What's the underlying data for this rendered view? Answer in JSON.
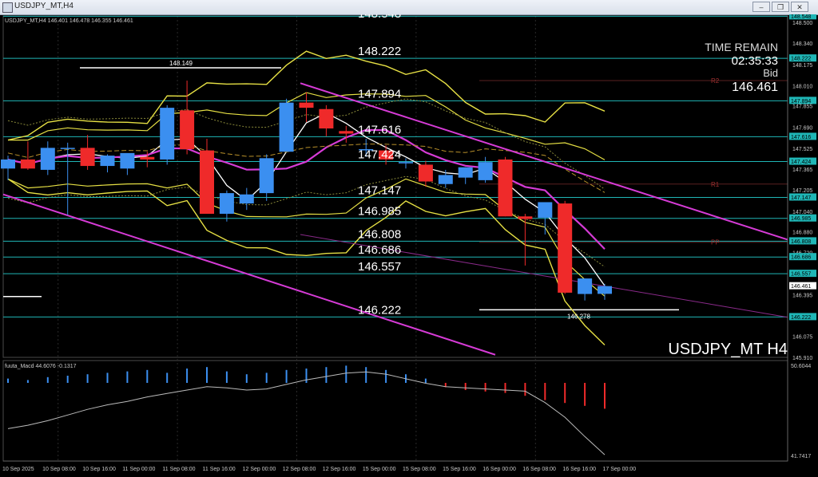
{
  "window": {
    "title": "USDJPY_MT,H4",
    "buttons": [
      "minimize",
      "restore",
      "close"
    ]
  },
  "colors": {
    "background": "#000000",
    "bull_candle": "#3b8ff0",
    "bear_candle": "#ef2a2a",
    "bollinger": "#e6e044",
    "channel": "#d63bd6",
    "level_line": "#1fb6b6",
    "ma_white": "#ffffff",
    "axis_text": "#c8c8c8"
  },
  "chart_data": [
    {
      "type": "candlestick",
      "symbol_label": "USDJPY_MT H4",
      "header": "USDJPY_MT,H4  146.401 146.478 146.355 146.461",
      "ylim": [
        145.91,
        148.55
      ],
      "ticks_y": [
        148.5,
        148.34,
        148.175,
        148.01,
        147.855,
        147.69,
        147.525,
        147.365,
        147.205,
        147.04,
        146.88,
        146.72,
        146.395,
        146.235,
        146.075,
        145.91
      ],
      "x_labels": [
        "10 Sep 2025",
        "10 Sep 08:00",
        "10 Sep 16:00",
        "11 Sep 00:00",
        "11 Sep 08:00",
        "11 Sep 16:00",
        "12 Sep 00:00",
        "12 Sep 08:00",
        "12 Sep 16:00",
        "15 Sep 00:00",
        "15 Sep 08:00",
        "15 Sep 16:00",
        "16 Sep 00:00",
        "16 Sep 08:00",
        "16 Sep 16:00",
        "17 Sep 00:00"
      ],
      "candles": [
        {
          "o": 147.37,
          "h": 147.47,
          "l": 147.28,
          "c": 147.44
        },
        {
          "o": 147.44,
          "h": 147.58,
          "l": 147.36,
          "c": 147.37
        },
        {
          "o": 147.36,
          "h": 147.58,
          "l": 147.32,
          "c": 147.53
        },
        {
          "o": 147.53,
          "h": 147.57,
          "l": 147.01,
          "c": 147.53
        },
        {
          "o": 147.53,
          "h": 147.63,
          "l": 147.36,
          "c": 147.39
        },
        {
          "o": 147.39,
          "h": 147.48,
          "l": 147.34,
          "c": 147.47
        },
        {
          "o": 147.37,
          "h": 147.48,
          "l": 147.32,
          "c": 147.49
        },
        {
          "o": 147.46,
          "h": 147.5,
          "l": 147.38,
          "c": 147.44
        },
        {
          "o": 147.44,
          "h": 147.86,
          "l": 147.4,
          "c": 147.84
        },
        {
          "o": 147.82,
          "h": 148.05,
          "l": 147.48,
          "c": 147.52
        },
        {
          "o": 147.51,
          "h": 147.6,
          "l": 147.05,
          "c": 147.02
        },
        {
          "o": 147.02,
          "h": 147.2,
          "l": 146.96,
          "c": 147.18
        },
        {
          "o": 147.1,
          "h": 147.22,
          "l": 147.05,
          "c": 147.17
        },
        {
          "o": 147.18,
          "h": 147.48,
          "l": 147.12,
          "c": 147.45
        },
        {
          "o": 147.5,
          "h": 147.91,
          "l": 147.5,
          "c": 147.88
        },
        {
          "o": 147.88,
          "h": 147.96,
          "l": 147.73,
          "c": 147.84
        },
        {
          "o": 147.83,
          "h": 147.86,
          "l": 147.62,
          "c": 147.68
        },
        {
          "o": 147.66,
          "h": 147.7,
          "l": 147.57,
          "c": 147.64
        },
        {
          "o": 147.52,
          "h": 147.6,
          "l": 147.46,
          "c": 147.52
        },
        {
          "o": 147.51,
          "h": 147.55,
          "l": 147.4,
          "c": 147.44
        },
        {
          "o": 147.41,
          "h": 147.45,
          "l": 147.37,
          "c": 147.42
        },
        {
          "o": 147.4,
          "h": 147.43,
          "l": 147.23,
          "c": 147.27
        },
        {
          "o": 147.25,
          "h": 147.36,
          "l": 147.22,
          "c": 147.32
        },
        {
          "o": 147.3,
          "h": 147.38,
          "l": 147.25,
          "c": 147.38
        },
        {
          "o": 147.28,
          "h": 147.46,
          "l": 147.26,
          "c": 147.42
        },
        {
          "o": 147.44,
          "h": 147.46,
          "l": 147.0,
          "c": 147.0
        },
        {
          "o": 147.0,
          "h": 147.02,
          "l": 146.62,
          "c": 146.98
        },
        {
          "o": 146.99,
          "h": 147.1,
          "l": 146.86,
          "c": 147.11
        },
        {
          "o": 147.1,
          "h": 147.12,
          "l": 146.4,
          "c": 146.41
        },
        {
          "o": 146.4,
          "h": 146.52,
          "l": 146.35,
          "c": 146.52
        },
        {
          "o": 146.401,
          "h": 146.478,
          "l": 146.355,
          "c": 146.461
        }
      ],
      "levels": [
        {
          "label": "148.222",
          "value": 148.222
        },
        {
          "label": "147.894",
          "value": 147.894
        },
        {
          "label": "147.616",
          "value": 147.616
        },
        {
          "label": "147.424",
          "value": 147.424
        },
        {
          "label": "147.147",
          "value": 147.147
        },
        {
          "label": "146.985",
          "value": 146.985
        },
        {
          "label": "146.808",
          "value": 146.808
        },
        {
          "label": "146.686",
          "value": 146.686
        },
        {
          "label": "146.557",
          "value": 146.557
        },
        {
          "label": "146.222",
          "value": 146.222
        }
      ],
      "axis_tags": [
        "148.548",
        "148.222",
        "147.894",
        "147.616",
        "147.424",
        "147.147",
        "146.985",
        "146.808",
        "146.686",
        "146.557",
        "146.461",
        "146.222"
      ],
      "pivot_labels": [
        "R2",
        "R1",
        "PP"
      ],
      "swing_labels": [
        {
          "text": "148.149",
          "value": 148.149
        },
        {
          "text": "146.278",
          "value": 146.278
        }
      ],
      "top_cut_label": "148.548",
      "panel": {
        "time_remain_label": "TIME REMAIN",
        "time_remain": "02:35:33",
        "bid_label": "Bid",
        "bid": "146.461"
      }
    },
    {
      "type": "bar",
      "name": "fuuta_Macd",
      "header": "fuuta_Macd 44.6076 -0.1317",
      "ylim": [
        41.7417,
        50.6044
      ],
      "ticks_y": [
        "50.6044",
        "41.7417"
      ],
      "histogram": [
        0.3,
        0.2,
        0.4,
        0.5,
        0.6,
        0.7,
        0.8,
        0.9,
        0.7,
        1.0,
        1.1,
        0.8,
        0.6,
        0.7,
        0.9,
        1.0,
        1.1,
        1.2,
        1.1,
        0.9,
        0.6,
        0.3,
        -0.3,
        -0.5,
        -0.6,
        -0.7,
        -0.9,
        -1.2,
        -1.4,
        -1.6,
        -1.8
      ],
      "signal": [
        44.6,
        44.9,
        45.3,
        45.8,
        46.3,
        46.7,
        47.0,
        47.4,
        47.7,
        48.0,
        48.3,
        48.2,
        48.0,
        48.1,
        48.5,
        48.9,
        49.2,
        49.5,
        49.6,
        49.4,
        49.0,
        48.6,
        48.3,
        48.2,
        48.1,
        48.0,
        47.9,
        46.9,
        45.6,
        43.9,
        42.3
      ]
    }
  ]
}
